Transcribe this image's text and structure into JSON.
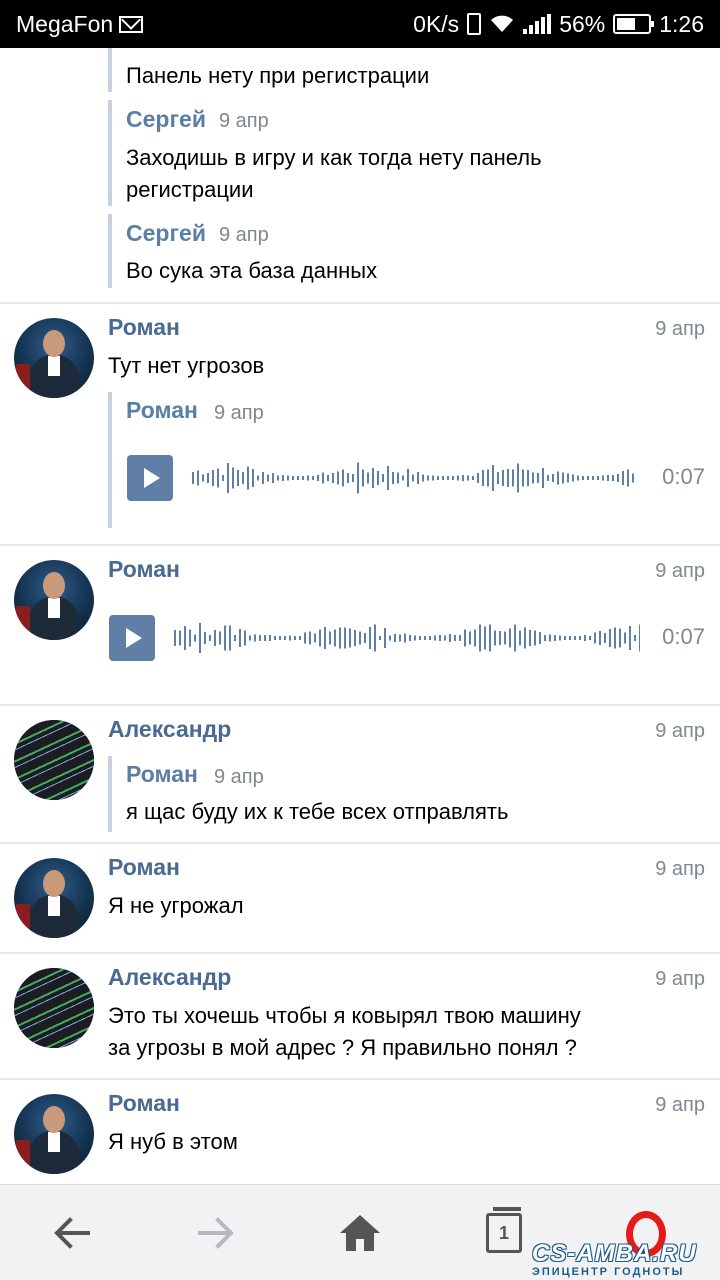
{
  "status_bar": {
    "carrier": "MegaFon",
    "net_speed": "0K/s",
    "battery": "56%",
    "time": "1:26"
  },
  "feed": {
    "top_quotes": [
      {
        "text": "Панель нету при регистрации"
      },
      {
        "author": "Сергей",
        "date": "9 апр",
        "lines": [
          "Заходишь в игру и как тогда нету панель",
          "регистрации"
        ]
      },
      {
        "author": "Сергей",
        "date": "9 апр",
        "lines": [
          "Во сука эта база данных"
        ]
      }
    ],
    "posts": [
      {
        "author": "Роман",
        "date": "9 апр",
        "text": "Тут нет угрозов",
        "quote": {
          "author": "Роман",
          "date": "9 апр",
          "audio": {
            "duration": "0:07"
          }
        }
      },
      {
        "author": "Роман",
        "date": "9 апр",
        "audio": {
          "duration": "0:07"
        }
      },
      {
        "author": "Александр",
        "date": "9 апр",
        "quote": {
          "author": "Роман",
          "date": "9 апр",
          "text": "я щас буду их к тебе всех отправлять"
        }
      },
      {
        "author": "Роман",
        "date": "9 апр",
        "text": "Я не угрожал"
      },
      {
        "author": "Александр",
        "date": "9 апр",
        "lines": [
          "Это ты хочешь чтобы я ковырял твою машину",
          "за угрозы в мой адрес ? Я правильно понял ?"
        ]
      },
      {
        "author": "Роман",
        "date": "9 апр",
        "text": "Я нуб в этом"
      }
    ]
  },
  "nav": {
    "tab_count": "1",
    "icons": [
      "back-arrow-icon",
      "forward-arrow-icon",
      "home-icon",
      "tabs-icon",
      "opera-icon"
    ]
  },
  "watermark": {
    "main": "CS-AMBA.RU",
    "sub": "ЭПИЦЕНТР ГОДНОТЫ"
  },
  "colors": {
    "name": "#4a6a91",
    "quote_bar": "#c6d2e0",
    "play_button": "#5f7fa6",
    "opera": "#e41b17"
  }
}
